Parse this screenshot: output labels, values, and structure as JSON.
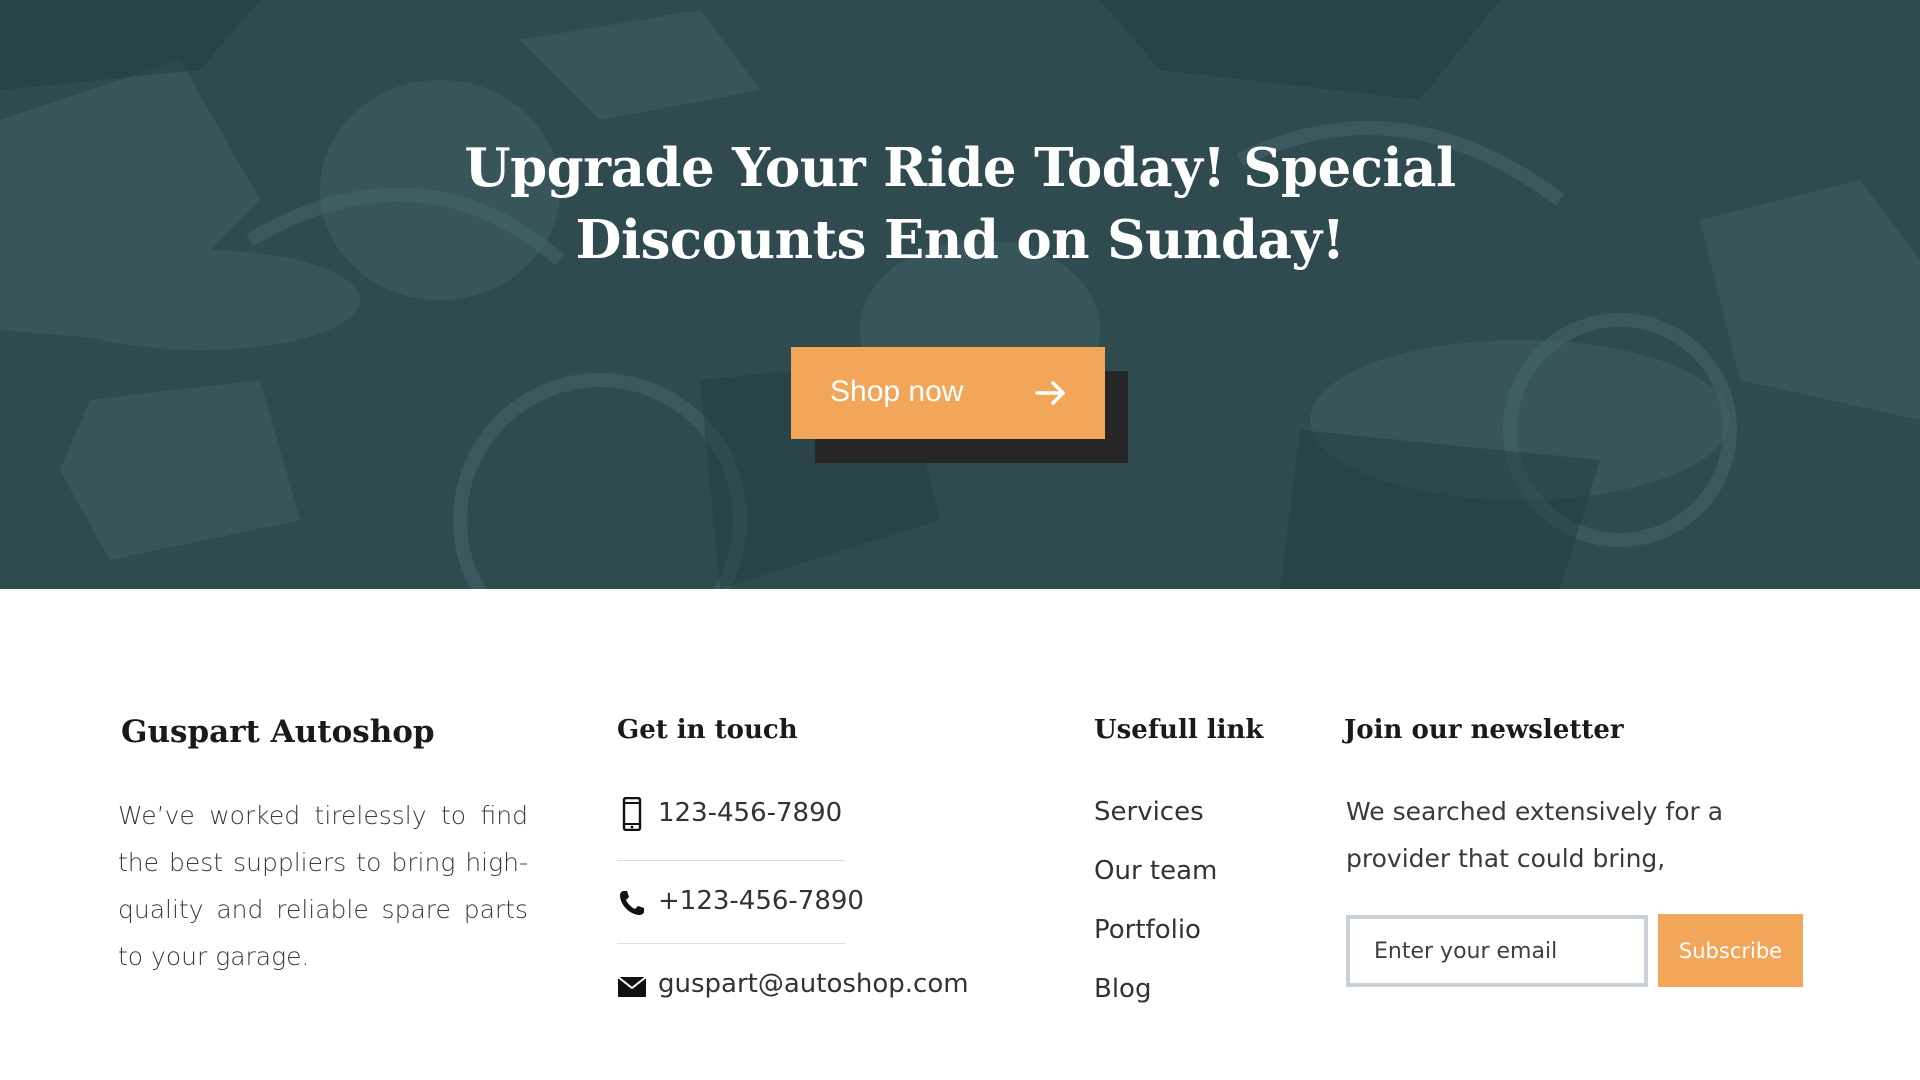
{
  "hero": {
    "title_line1": "Upgrade Your Ride Today! Special",
    "title_line2": "Discounts End on Sunday!",
    "cta_label": "Shop now",
    "cta_icon": "arrow-right-icon"
  },
  "about": {
    "heading": "Guspart Autoshop",
    "text": "We’ve worked tirelessly to find the best suppliers to bring high-quality and reliable spare parts to your garage."
  },
  "contact": {
    "heading": "Get in touch",
    "items": [
      {
        "icon": "mobile-phone-icon",
        "text": "123-456-7890"
      },
      {
        "icon": "phone-icon",
        "text": "+123-456-7890"
      },
      {
        "icon": "envelope-icon",
        "text": "guspart@autoshop.com"
      }
    ]
  },
  "links": {
    "heading": "Usefull link",
    "items": [
      "Services",
      "Our team",
      "Portfolio",
      "Blog"
    ]
  },
  "newsletter": {
    "heading": "Join our newsletter",
    "text": "We searched extensively for a provider that could bring,",
    "input_placeholder": "Enter your email",
    "button_label": "Subscribe"
  },
  "colors": {
    "hero_background": "#324e52",
    "accent": "#f2a65a",
    "button_shadow": "#262626",
    "input_border": "#c9d0d8"
  }
}
